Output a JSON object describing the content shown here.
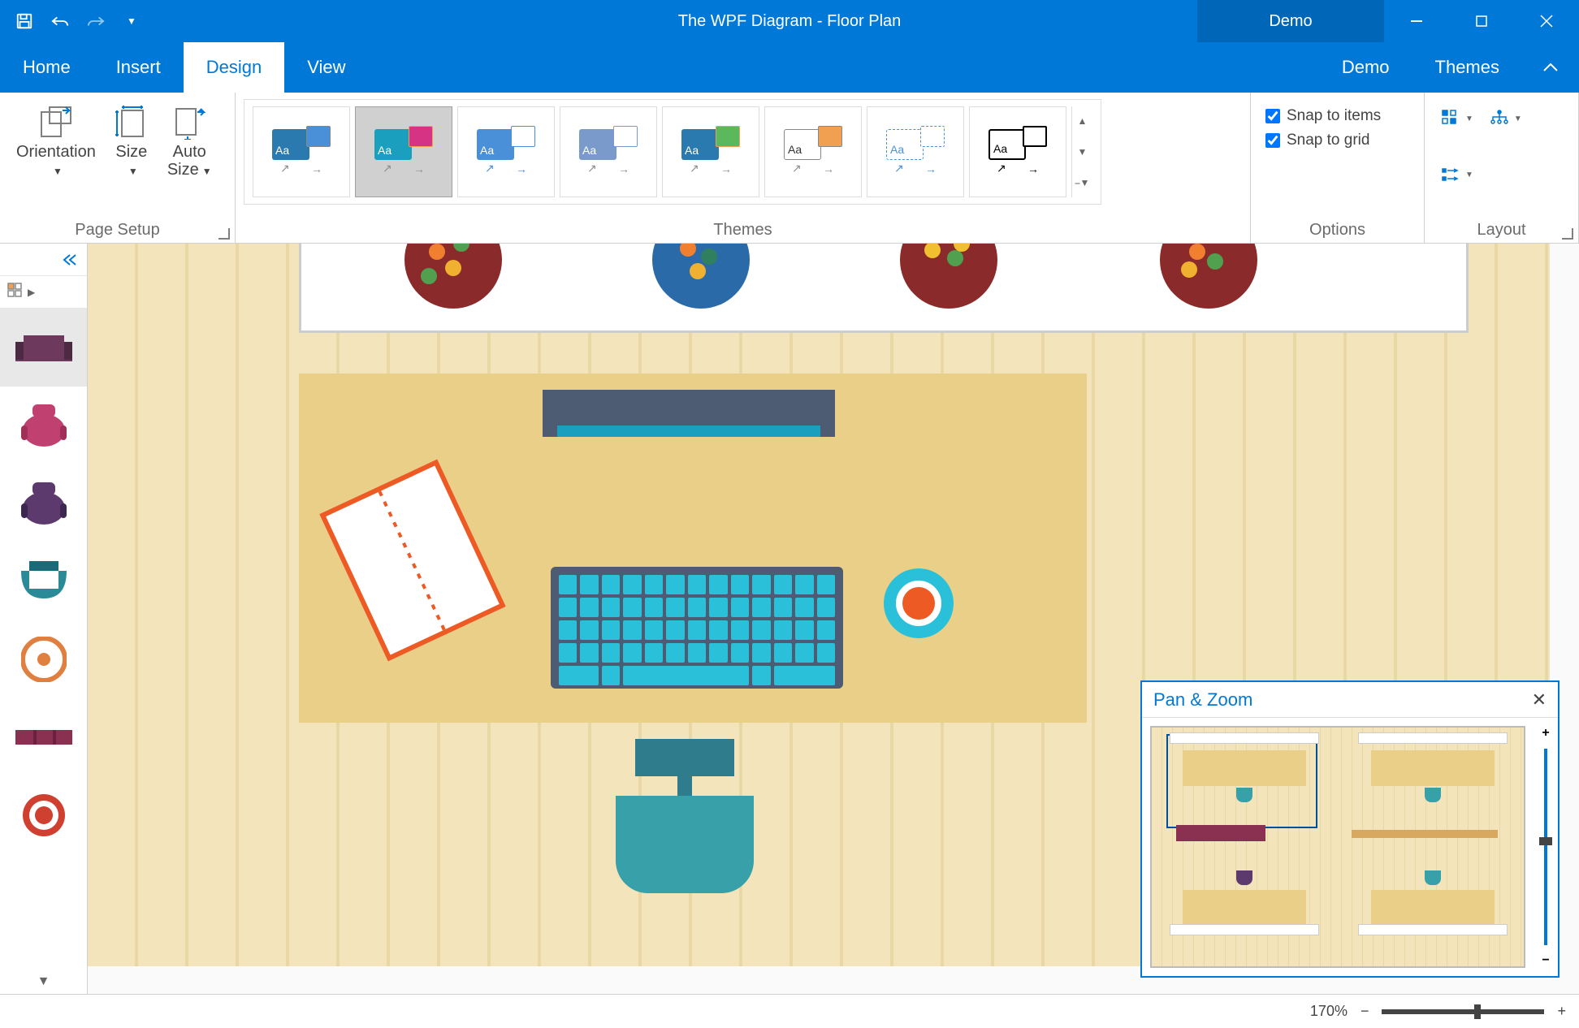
{
  "titlebar": {
    "title": "The WPF Diagram - Floor Plan",
    "demo_label": "Demo"
  },
  "tabs": {
    "home": "Home",
    "insert": "Insert",
    "design": "Design",
    "view": "View",
    "demo": "Demo",
    "themes": "Themes"
  },
  "ribbon": {
    "page_setup": {
      "orientation": "Orientation",
      "size": "Size",
      "auto_size": "Auto\nSize",
      "group": "Page Setup"
    },
    "themes": {
      "group": "Themes",
      "label_prefix": "Aa"
    },
    "options": {
      "snap_items": "Snap to items",
      "snap_grid": "Snap to grid",
      "group": "Options"
    },
    "layout": {
      "group": "Layout"
    }
  },
  "panzoom": {
    "title": "Pan & Zoom"
  },
  "statusbar": {
    "zoom": "170%"
  },
  "stencil": {
    "shapes": [
      "sofa",
      "chair-round-pink",
      "chair-round-purple",
      "chair-armchair-teal",
      "circle-target",
      "bench",
      "coffee-cup-red"
    ]
  }
}
